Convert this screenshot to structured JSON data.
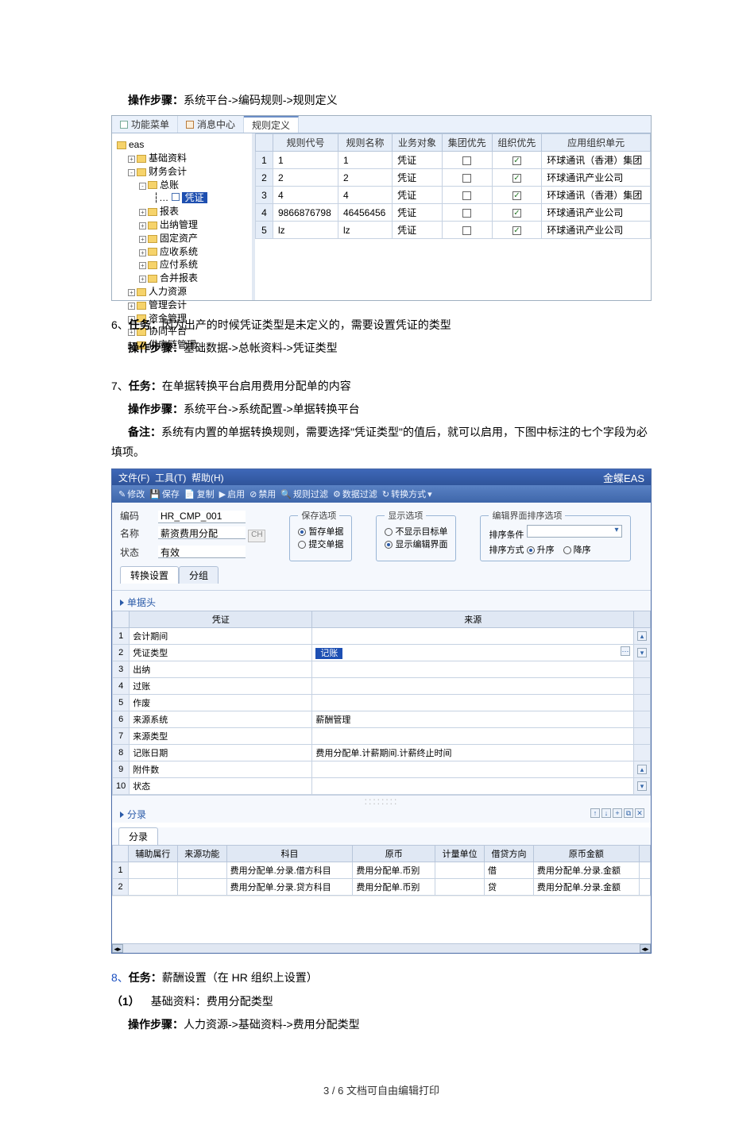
{
  "intro": {
    "steps_label": "操作步骤：",
    "steps_path": "系统平台->编码规则->规则定义"
  },
  "app1": {
    "tabs": {
      "func_menu": "功能菜单",
      "msg_center": "消息中心",
      "rule_def": "规则定义"
    },
    "tree": {
      "root": "eas",
      "n1": "基础资料",
      "n2": "财务会计",
      "n2_1": "总账",
      "n2_1_1": "凭证",
      "n2_2": "报表",
      "n2_3": "出纳管理",
      "n2_4": "固定资产",
      "n2_5": "应收系统",
      "n2_6": "应付系统",
      "n2_7": "合并报表",
      "n3": "人力资源",
      "n4": "管理会计",
      "n5": "资金管理",
      "n6": "协同平台",
      "n7": "供应链管理"
    },
    "columns": {
      "rule_code": "规则代号",
      "rule_name": "规则名称",
      "biz_obj": "业务对象",
      "group_pri": "集团优先",
      "org_pri": "组织优先",
      "app_org": "应用组织单元"
    },
    "rows": [
      {
        "num": "1",
        "code": "1",
        "name": "1",
        "obj": "凭证",
        "group": false,
        "org": true,
        "unit": "环球通讯（香港）集团"
      },
      {
        "num": "2",
        "code": "2",
        "name": "2",
        "obj": "凭证",
        "group": false,
        "org": true,
        "unit": "环球通讯产业公司"
      },
      {
        "num": "3",
        "code": "4",
        "name": "4",
        "obj": "凭证",
        "group": false,
        "org": true,
        "unit": "环球通讯（香港）集团"
      },
      {
        "num": "4",
        "code": "9866876798",
        "name": "46456456",
        "obj": "凭证",
        "group": false,
        "org": true,
        "unit": "环球通讯产业公司"
      },
      {
        "num": "5",
        "code": "lz",
        "name": "lz",
        "obj": "凭证",
        "group": false,
        "org": true,
        "unit": "环球通讯产业公司"
      }
    ]
  },
  "task6": {
    "num": "6、",
    "label": "任务：",
    "text": "因为出产的时候凭证类型是未定义的，需要设置凭证的类型",
    "steps_label": "操作步骤：",
    "steps_path": "基础数据->总帐资料->凭证类型"
  },
  "task7": {
    "num": "7、",
    "label": "任务：",
    "text": "在单据转换平台启用费用分配单的内容",
    "steps_label": "操作步骤：",
    "steps_path": "系统平台->系统配置->单据转换平台",
    "note_label": "备注：",
    "note_text": "系统有内置的单据转换规则，需要选择\"凭证类型\"的值后，就可以启用，下图中标注的七个字段为必填项。"
  },
  "app2": {
    "menubar": {
      "file": "文件(F)",
      "tool": "工具(T)",
      "help": "帮助(H)",
      "brand": "金蝶EAS"
    },
    "toolbar": {
      "modify": "修改",
      "save": "保存",
      "copy": "复制",
      "enable": "启用",
      "disable": "禁用",
      "rulefilter": "规则过滤",
      "datafilter": "数据过滤",
      "convert": "转换方式"
    },
    "form": {
      "code_lbl": "编码",
      "code_val": "HR_CMP_001",
      "name_lbl": "名称",
      "name_val": "薪资费用分配",
      "lang": "CH",
      "status_lbl": "状态",
      "status_val": "有效",
      "save_opt_legend": "保存选项",
      "save_opt_draft": "暂存单据",
      "save_opt_submit": "提交单据",
      "disp_opt_legend": "显示选项",
      "disp_opt_notarget": "不显示目标单",
      "disp_opt_showedit": "显示编辑界面",
      "sort_legend": "编辑界面排序选项",
      "sort_field_lbl": "排序条件",
      "sort_mode_lbl": "排序方式",
      "sort_asc": "升序",
      "sort_desc": "降序"
    },
    "subtabs": {
      "convset": "转换设置",
      "group": "分组"
    },
    "sec_head": "单据头",
    "grid1": {
      "col_voucher": "凭证",
      "col_source": "来源",
      "rows": [
        {
          "n": "1",
          "f": "会计期间",
          "v": ""
        },
        {
          "n": "2",
          "f": "凭证类型",
          "v": "记账",
          "hl": true
        },
        {
          "n": "3",
          "f": "出纳",
          "v": ""
        },
        {
          "n": "4",
          "f": "过账",
          "v": ""
        },
        {
          "n": "5",
          "f": "作废",
          "v": ""
        },
        {
          "n": "6",
          "f": "来源系统",
          "v": "薪酬管理"
        },
        {
          "n": "7",
          "f": "来源类型",
          "v": ""
        },
        {
          "n": "8",
          "f": "记账日期",
          "v": "费用分配单.计薪期间.计薪终止时间"
        },
        {
          "n": "9",
          "f": "附件数",
          "v": ""
        },
        {
          "n": "10",
          "f": "状态",
          "v": ""
        }
      ]
    },
    "sec_entry": "分录",
    "entry_tab": "分录",
    "grid2": {
      "c_assist": "辅助属行",
      "c_srcfn": "来源功能",
      "c_subject": "科目",
      "c_orig": "原币",
      "c_unit": "计量单位",
      "c_dc": "借贷方向",
      "c_amt": "原币金额",
      "rows": [
        {
          "n": "1",
          "subject": "费用分配单.分录.借方科目",
          "orig": "费用分配单.币别",
          "dc": "借",
          "amt": "费用分配单.分录.金额"
        },
        {
          "n": "2",
          "subject": "费用分配单.分录.贷方科目",
          "orig": "费用分配单.币别",
          "dc": "贷",
          "amt": "费用分配单.分录.金额"
        }
      ]
    }
  },
  "task8": {
    "num": "8、",
    "label": "任务：",
    "text": "薪酬设置（在 HR 组织上设置）",
    "sub1_num": "（1）",
    "sub1": "基础资料：费用分配类型",
    "steps_label": "操作步骤：",
    "steps_path": "人力资源->基础资料->费用分配类型"
  },
  "footer": {
    "page": "3 / 6",
    "note": "文档可自由编辑打印"
  }
}
